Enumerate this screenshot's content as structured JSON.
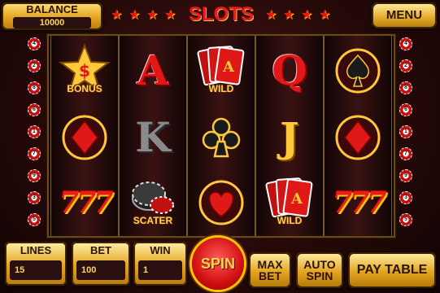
{
  "header": {
    "balance_label": "BALANCE",
    "balance_value": "10000",
    "title": "SLOTS",
    "menu_label": "MENU"
  },
  "reels": [
    [
      "BONUS",
      "diamond",
      "777"
    ],
    [
      "A",
      "K",
      "SCATER"
    ],
    [
      "WILD",
      "club",
      "heart"
    ],
    [
      "Q",
      "J",
      "WILD"
    ],
    [
      "spade",
      "diamond",
      "777"
    ]
  ],
  "symbol_text": {
    "bonus": "BONUS",
    "wild": "WILD",
    "scater": "SCATER",
    "ace": "A",
    "king": "K",
    "queen": "Q",
    "jack": "J",
    "sevens": "777"
  },
  "paylines": {
    "left": [
      "4",
      "2",
      "8",
      "6",
      "1",
      "7",
      "9",
      "3",
      "5"
    ],
    "right": [
      "4",
      "2",
      "8",
      "6",
      "1",
      "7",
      "9",
      "3",
      "5"
    ]
  },
  "footer": {
    "lines_label": "LINES",
    "lines_value": "15",
    "bet_label": "BET",
    "bet_value": "100",
    "win_label": "WIN",
    "win_value": "1",
    "spin_label": "SPIN",
    "maxbet_line1": "MAX",
    "maxbet_line2": "BET",
    "autospin_line1": "AUTO",
    "autospin_line2": "SPIN",
    "paytable_label": "PAY TABLE"
  },
  "colors": {
    "accent_red": "#e01818",
    "gold": "#e3a41f",
    "panel_dark": "#2a1010",
    "value_text": "#ffd84a"
  }
}
